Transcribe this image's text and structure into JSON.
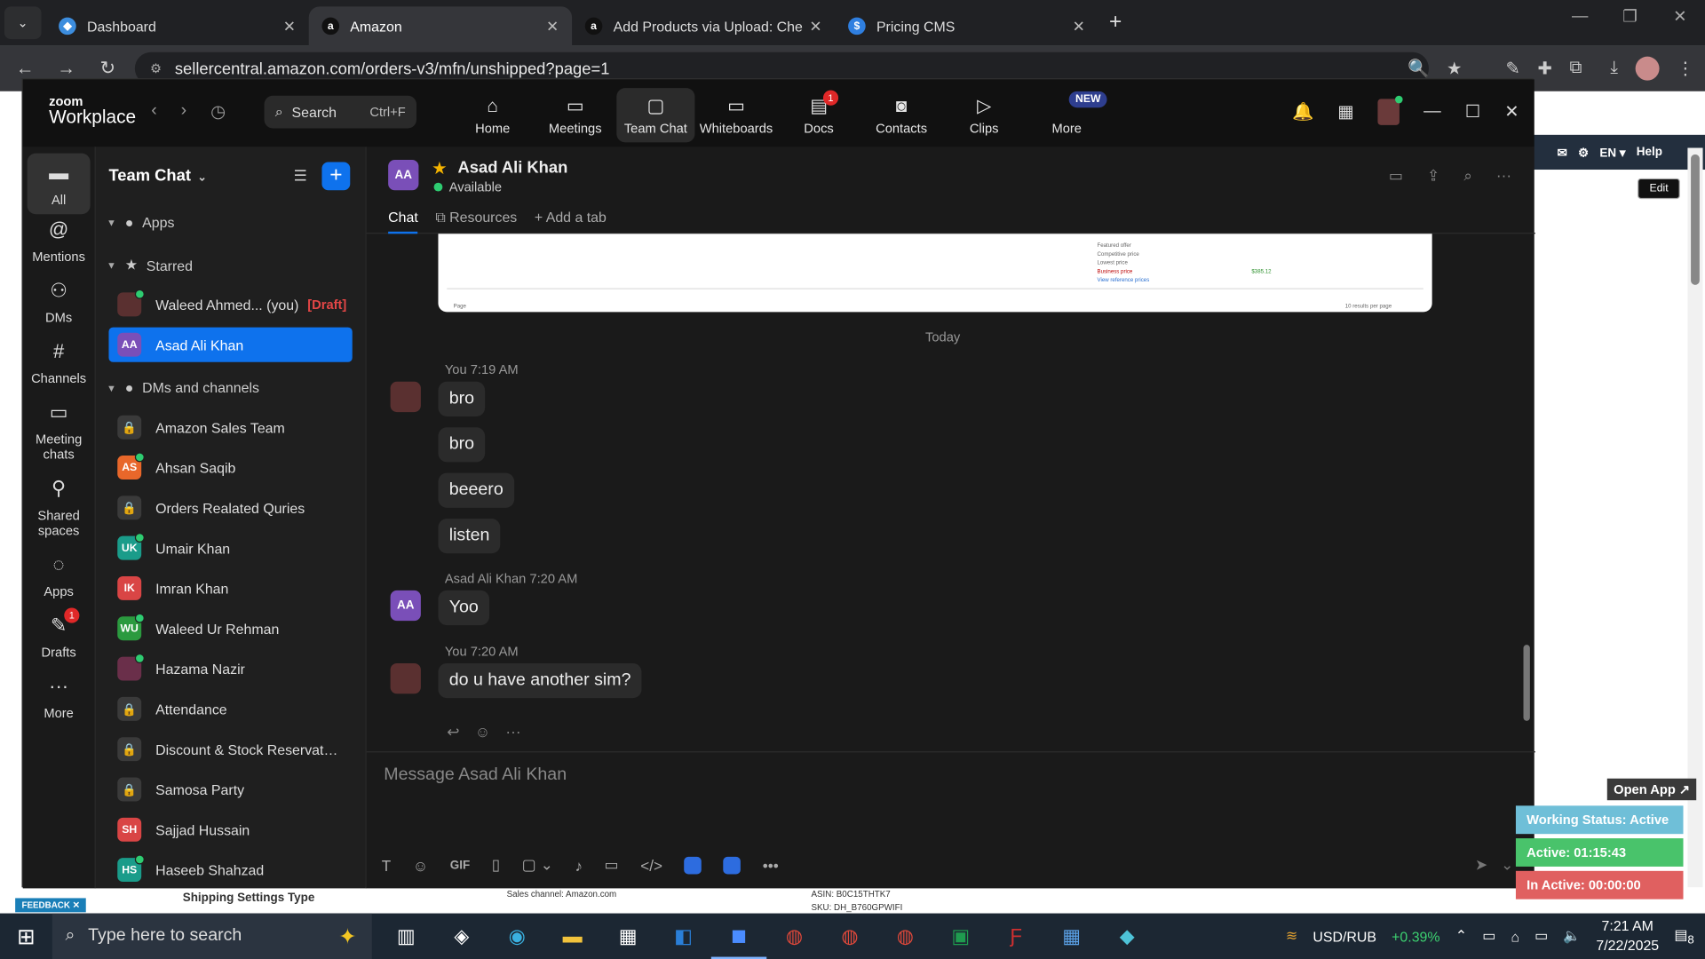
{
  "browser": {
    "tabs": [
      {
        "title": "Dashboard",
        "icon": "globe-tab-icon",
        "active": false
      },
      {
        "title": "Amazon",
        "icon": "amazon-icon",
        "active": true
      },
      {
        "title": "Add Products via Upload: Chec",
        "icon": "amazon-icon",
        "active": false
      },
      {
        "title": "Pricing CMS",
        "icon": "dollar-icon",
        "active": false
      }
    ],
    "url": "sellercentral.amazon.com/orders-v3/mfn/unshipped?page=1"
  },
  "amazon": {
    "top_links": [
      "EN ▾",
      "Help"
    ],
    "edit_label": "Edit",
    "shipping_settings": "Shipping Settings Type",
    "sales_channel": "Sales channel: Amazon.com",
    "asin": "ASIN: B0C15THTK7",
    "sku": "SKU: DH_B760GPWIFI",
    "feedback": "FEEDBACK"
  },
  "zoom": {
    "logo_top": "zoom",
    "logo_bottom": "Workplace",
    "search": {
      "label": "Search",
      "shortcut": "Ctrl+F"
    },
    "menu": [
      {
        "label": "Home",
        "icon": "home-icon"
      },
      {
        "label": "Meetings",
        "icon": "camera-icon"
      },
      {
        "label": "Team Chat",
        "icon": "chat-icon",
        "active": true
      },
      {
        "label": "Whiteboards",
        "icon": "whiteboard-icon"
      },
      {
        "label": "Docs",
        "icon": "docs-icon",
        "badge": "1"
      },
      {
        "label": "Contacts",
        "icon": "contacts-icon"
      },
      {
        "label": "Clips",
        "icon": "clips-icon"
      },
      {
        "label": "More",
        "icon": "more-icon",
        "tag": "NEW"
      }
    ],
    "rail": [
      {
        "label": "All",
        "icon": "chat-bubble-icon",
        "active": true
      },
      {
        "label": "Mentions",
        "icon": "at-icon"
      },
      {
        "label": "DMs",
        "icon": "people-icon"
      },
      {
        "label": "Channels",
        "icon": "hash-icon"
      },
      {
        "label": "Meeting chats",
        "icon": "calendar-icon"
      },
      {
        "label": "Shared spaces",
        "icon": "share-icon"
      },
      {
        "label": "Apps",
        "icon": "apps-icon"
      },
      {
        "label": "Drafts",
        "icon": "draft-icon",
        "badge": "1"
      },
      {
        "label": "More",
        "icon": "ellipsis-icon"
      }
    ],
    "panel": {
      "title": "Team Chat",
      "sections": {
        "apps": "Apps",
        "starred": "Starred",
        "dms": "DMs and channels"
      },
      "starred": [
        {
          "name": "Waleed Ahmed... (you)",
          "draft": "[Draft]",
          "avatar": "photo"
        },
        {
          "name": "Asad Ali Khan",
          "initials": "AA",
          "color": "#7a4fb8",
          "selected": true
        }
      ],
      "channels": [
        {
          "name": "Amazon Sales Team",
          "type": "lock"
        },
        {
          "name": "Ahsan Saqib",
          "initials": "AS",
          "color": "#e8672a"
        },
        {
          "name": "Orders Realated Quries",
          "type": "lock"
        },
        {
          "name": "Umair Khan",
          "initials": "UK",
          "color": "#1a9c8a"
        },
        {
          "name": "Imran Khan",
          "initials": "IK",
          "color": "#d94545"
        },
        {
          "name": "Waleed Ur Rehman",
          "initials": "WU",
          "color": "#2b9a3f"
        },
        {
          "name": "Hazama Nazir",
          "initials": "",
          "color": "#6a2f4a"
        },
        {
          "name": "Attendance",
          "type": "lock"
        },
        {
          "name": "Discount & Stock Reservatio...",
          "type": "lock"
        },
        {
          "name": "Samosa Party",
          "type": "lock"
        },
        {
          "name": "Sajjad Hussain",
          "initials": "SH",
          "color": "#d94545"
        },
        {
          "name": "Haseeb Shahzad",
          "initials": "HS",
          "color": "#1a9c8a"
        }
      ]
    },
    "chat": {
      "contact": "Asad Ali Khan",
      "initials": "AA",
      "status": "Available",
      "tabs": [
        "Chat",
        "Resources",
        "+ Add a tab"
      ],
      "date_divider": "Today",
      "shot_text": {
        "featured": "Featured offer",
        "competitive": "Competitive price",
        "lowest": "Lowest price",
        "business": "Business price",
        "business_val": "$385.12",
        "ref": "View reference prices",
        "page": "Page",
        "results": "10 results per page"
      },
      "groups": [
        {
          "sender": "You",
          "time": "7:19 AM",
          "messages": [
            "bro",
            "bro",
            "beeero",
            "listen"
          ]
        },
        {
          "sender": "Asad Ali Khan",
          "time": "7:20 AM",
          "messages": [
            "Yoo"
          ]
        },
        {
          "sender": "You",
          "time": "7:20 AM",
          "messages": [
            "do u have another sim?"
          ]
        }
      ],
      "composer_placeholder": "Message Asad Ali Khan",
      "composer_gif": "GIF"
    }
  },
  "widget": {
    "open_app": "Open App ↗",
    "working_status": "Working Status: Active",
    "active": "Active: 01:15:43",
    "inactive": "In Active: 00:00:00"
  },
  "taskbar": {
    "search_placeholder": "Type here to search",
    "currency": "USD/RUB",
    "change": "+0.39%",
    "time": "7:21 AM",
    "date": "7/22/2025",
    "notifications": "8"
  }
}
